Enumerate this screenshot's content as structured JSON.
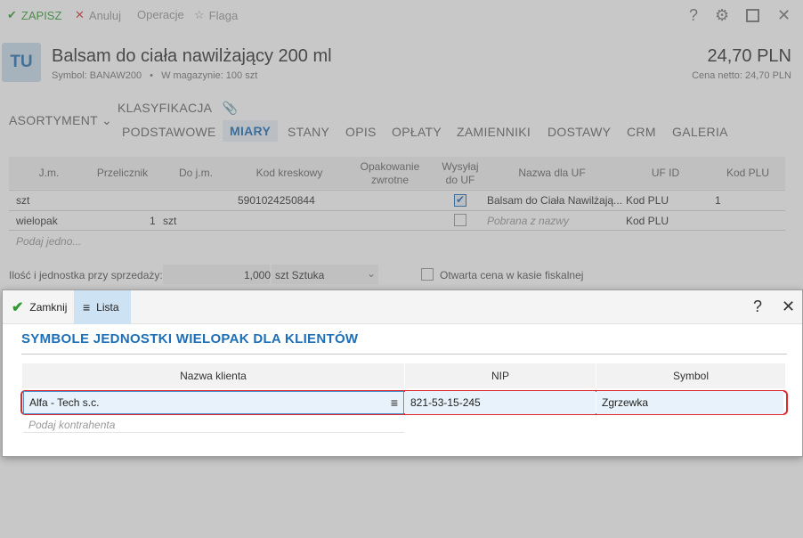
{
  "toolbar": {
    "save": "ZAPISZ",
    "cancel": "Anuluj",
    "operations": "Operacje",
    "flag": "Flaga",
    "icons": [
      "help-icon",
      "gear-icon",
      "maximize-icon",
      "close-icon"
    ]
  },
  "header": {
    "badge": "TU",
    "title": "Balsam do ciała nawilżający 200 ml",
    "symbol_line": "Symbol: BANAW200",
    "stock_line": "W magazynie: 100 szt",
    "price": "24,70 PLN",
    "net_price": "Cena netto: 24,70 PLN"
  },
  "tabs": {
    "assortment": "ASORTYMENT",
    "classification": "KLASYFIKACJA",
    "items": [
      "PODSTAWOWE",
      "MIARY",
      "STANY",
      "OPIS",
      "OPŁATY",
      "ZAMIENNIKI",
      "DOSTAWY",
      "CRM",
      "GALERIA"
    ],
    "active": "MIARY"
  },
  "units_table": {
    "headers": [
      "J.m.",
      "Przelicznik",
      "Do j.m.",
      "Kod kreskowy",
      "Opakowanie zwrotne",
      "Wysyłaj do UF",
      "Nazwa dla UF",
      "UF ID",
      "Kod PLU"
    ],
    "rows": [
      {
        "jm": "szt",
        "factor": "",
        "to": "",
        "barcode": "5901024250844",
        "send": true,
        "name": "Balsam do Ciała Nawilżają...",
        "ufid": "Kod PLU",
        "plu": "1"
      },
      {
        "jm": "wielopak",
        "factor": "1",
        "to": "szt",
        "barcode": "",
        "send": false,
        "name": "Pobrana z nazwy",
        "ufid": "Kod PLU",
        "plu": ""
      }
    ],
    "placeholder": "Podaj jedno..."
  },
  "sale": {
    "label": "Ilość i jednostka przy sprzedaży:",
    "qty": "1,000",
    "unit": "szt  Sztuka",
    "open_price": "Otwarta cena w kasie fiskalnej"
  },
  "dialog": {
    "close": "Zamknij",
    "list": "Lista",
    "title": "SYMBOLE JEDNOSTKI WIELOPAK DLA KLIENTÓW",
    "columns": [
      "Nazwa klienta",
      "NIP",
      "Symbol"
    ],
    "rows": [
      {
        "client": "Alfa - Tech s.c.",
        "nip": "821-53-15-245",
        "symbol": "Zgrzewka"
      }
    ],
    "placeholder": "Podaj kontrahenta",
    "highlight_color": "#e0262e"
  },
  "colors": {
    "accent": "#1d6fb8",
    "save": "#3aa13a"
  }
}
